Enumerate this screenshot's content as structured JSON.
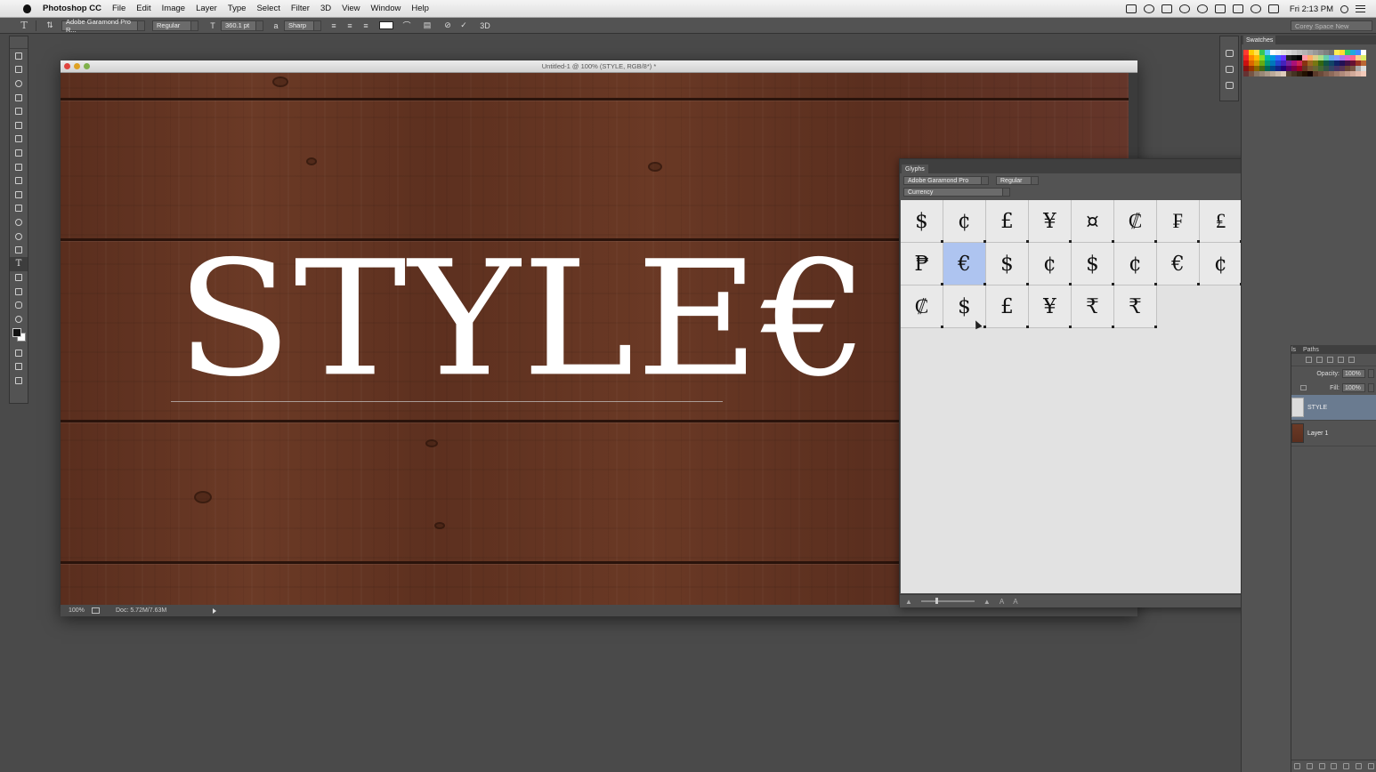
{
  "menubar": {
    "app_name": "Photoshop CC",
    "items": [
      "File",
      "Edit",
      "Image",
      "Layer",
      "Type",
      "Select",
      "Filter",
      "3D",
      "View",
      "Window",
      "Help"
    ],
    "clock": "Fri 2:13 PM"
  },
  "options_bar": {
    "font_family": "Adobe Garamond Pro R...",
    "font_style": "Regular",
    "font_size": "360.1 pt",
    "antialias": "Sharp",
    "mode_3d": "3D",
    "workspace": "Corey Space New"
  },
  "document": {
    "title": "Untitled-1 @ 100% (STYLE, RGB/8*) *",
    "canvas_text": "STYLE€",
    "zoom": "100%",
    "doc_size": "Doc: 5.72M/7.63M"
  },
  "glyphs_panel": {
    "tab": "Glyphs",
    "font": "Adobe Garamond Pro",
    "style": "Regular",
    "category": "Currency",
    "glyphs": [
      "$",
      "¢",
      "£",
      "¥",
      "¤",
      "₡",
      "₣",
      "₤",
      "₱",
      "€",
      "$",
      "¢",
      "$",
      "¢",
      "€",
      "¢",
      "₡",
      "$",
      "£",
      "¥",
      "₹",
      "₹"
    ],
    "selected_index": 9
  },
  "swatches_panel": {
    "tab": "Swatches",
    "colors": [
      "#ff3b30",
      "#ffcc00",
      "#ffe14d",
      "#34c759",
      "#5ac8fa",
      "#ffffff",
      "#f2f2f2",
      "#e5e5e5",
      "#d9d9d9",
      "#cccccc",
      "#bfbfbf",
      "#b3b3b3",
      "#a6a6a6",
      "#999999",
      "#8c8c8c",
      "#808080",
      "#737373",
      "#ffee55",
      "#ffdd33",
      "#33cc66",
      "#22aadd",
      "#4488ff",
      "#ffffff",
      "#ee2222",
      "#ff8800",
      "#ffbb00",
      "#88dd22",
      "#00bb99",
      "#0099dd",
      "#3366ff",
      "#6633ff",
      "#222222",
      "#111111",
      "#000000",
      "#ff99aa",
      "#ffaa66",
      "#ddcc88",
      "#aadd88",
      "#66ccaa",
      "#66aaee",
      "#8899ff",
      "#aa77ee",
      "#dd66cc",
      "#ff6688",
      "#ffcc88",
      "#ddee66",
      "#cc1111",
      "#dd6600",
      "#cc9900",
      "#66aa11",
      "#009977",
      "#0077bb",
      "#2244cc",
      "#4422bb",
      "#772299",
      "#aa1177",
      "#cc2255",
      "#883311",
      "#996622",
      "#777711",
      "#336611",
      "#115544",
      "#114466",
      "#112266",
      "#221155",
      "#441144",
      "#661133",
      "#993322",
      "#bb6633",
      "#881111",
      "#993300",
      "#886600",
      "#446611",
      "#006655",
      "#004488",
      "#112288",
      "#220077",
      "#550066",
      "#770044",
      "#990022",
      "#663322",
      "#775533",
      "#666633",
      "#446633",
      "#335544",
      "#334466",
      "#443366",
      "#553355",
      "#664433",
      "#775544",
      "#aaaaaa",
      "#dddddd",
      "#663333",
      "#775544",
      "#887766",
      "#998877",
      "#aa9988",
      "#bbaa99",
      "#ccbbaa",
      "#ddccbb",
      "#554433",
      "#443322",
      "#332211",
      "#221100",
      "#110000",
      "#5a3a2a",
      "#6b4a3a",
      "#7c5a4a",
      "#8d6a5a",
      "#9e7a6a",
      "#af8a7a",
      "#c09a8a",
      "#d1aa9a",
      "#e2baaa",
      "#f3caba"
    ]
  },
  "layers_panel": {
    "tab_partial": "ls",
    "tab_paths": "Paths",
    "opacity_label": "Opacity:",
    "opacity": "100%",
    "fill_label": "Fill:",
    "fill": "100%",
    "layers": [
      {
        "name": "STYLE",
        "active": true,
        "kind": "text"
      },
      {
        "name": "Layer 1",
        "active": false,
        "kind": "wood"
      }
    ]
  }
}
